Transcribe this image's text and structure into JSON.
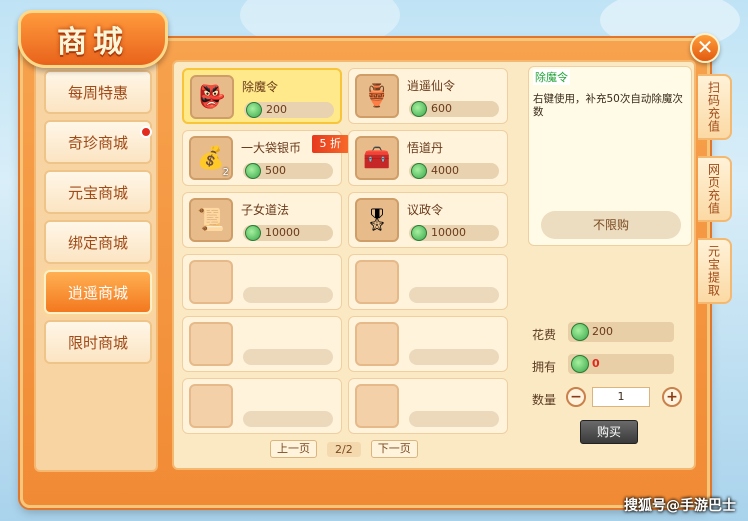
{
  "title": "商城",
  "sidebar": {
    "items": [
      {
        "label": "每周特惠",
        "active": false,
        "badge": false
      },
      {
        "label": "奇珍商城",
        "active": false,
        "badge": true
      },
      {
        "label": "元宝商城",
        "active": false,
        "badge": false
      },
      {
        "label": "绑定商城",
        "active": false,
        "badge": false
      },
      {
        "label": "逍遥商城",
        "active": true,
        "badge": false
      },
      {
        "label": "限时商城",
        "active": false,
        "badge": false
      }
    ]
  },
  "items": [
    {
      "name": "除魔令",
      "price": "200",
      "icon": "mask-icon",
      "selected": true
    },
    {
      "name": "逍遥仙令",
      "price": "600",
      "icon": "token-icon",
      "selected": false
    },
    {
      "name": "一大袋银币",
      "price": "500",
      "icon": "silver-bag-icon",
      "qty": "2",
      "discount": "5 折"
    },
    {
      "name": "悟道丹",
      "price": "4000",
      "icon": "pill-box-icon"
    },
    {
      "name": "子女道法",
      "price": "10000",
      "icon": "scroll-icon"
    },
    {
      "name": "议政令",
      "price": "10000",
      "icon": "order-icon"
    }
  ],
  "detail": {
    "title": "除魔令",
    "description": "右键使用，补充50次自动除魔次数",
    "limit": "不限购",
    "cost_label": "花费",
    "cost_value": "200",
    "own_label": "拥有",
    "own_value": "0",
    "qty_label": "数量",
    "qty_value": "1",
    "minus": "−",
    "plus": "+",
    "buy": "购买"
  },
  "pager": {
    "prev": "上一页",
    "page": "2/2",
    "next": "下一页"
  },
  "tabs": [
    "扫码充值",
    "网页充值",
    "元宝提取"
  ],
  "close": "✕",
  "watermark": "搜狐号@手游巴士"
}
